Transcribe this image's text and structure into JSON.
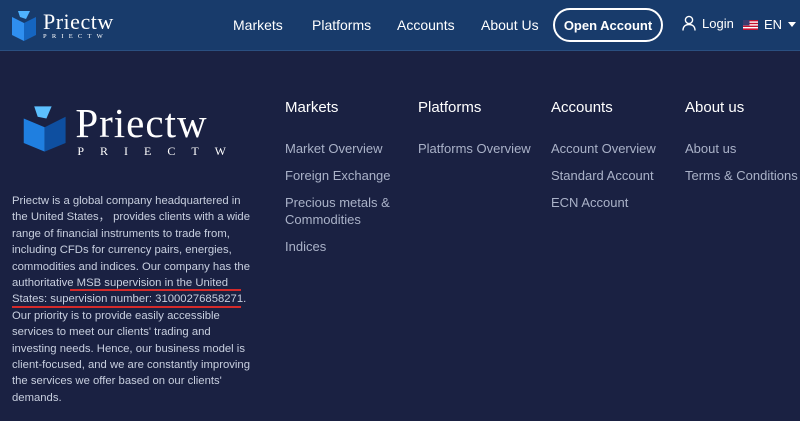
{
  "brand": {
    "name": "Priectw",
    "sub": "PRIECTW"
  },
  "header": {
    "nav": [
      "Markets",
      "Platforms",
      "Accounts",
      "About Us"
    ],
    "open_account": "Open Account",
    "login": "Login",
    "language": "EN"
  },
  "footer": {
    "about_text": "Priectw is a global company headquartered in the United States， provides clients with a wide range of financial instruments to trade from, including CFDs for currency pairs, energies, commodities and indices. Our company has the authoritative MSB supervision in the United States: supervision number: 31000276858271. Our priority is to provide easily accessible services to meet our clients' trading and investing needs. Hence, our business model is client-focused, and we are constantly improving the services we offer based on our clients' demands.",
    "columns": [
      {
        "heading": "Markets",
        "links": [
          "Market Overview",
          "Foreign Exchange",
          "Precious metals &",
          "Commodities",
          "Indices"
        ]
      },
      {
        "heading": "Platforms",
        "links": [
          "Platforms Overview"
        ]
      },
      {
        "heading": "Accounts",
        "links": [
          "Account Overview",
          "Standard Account",
          "ECN Account"
        ]
      },
      {
        "heading": "About us",
        "links": [
          "About us",
          "Terms & Conditions"
        ]
      }
    ]
  },
  "colors": {
    "header_bg": "#183b6b",
    "page_bg": "#1a2142",
    "highlight": "#d52a2a"
  }
}
